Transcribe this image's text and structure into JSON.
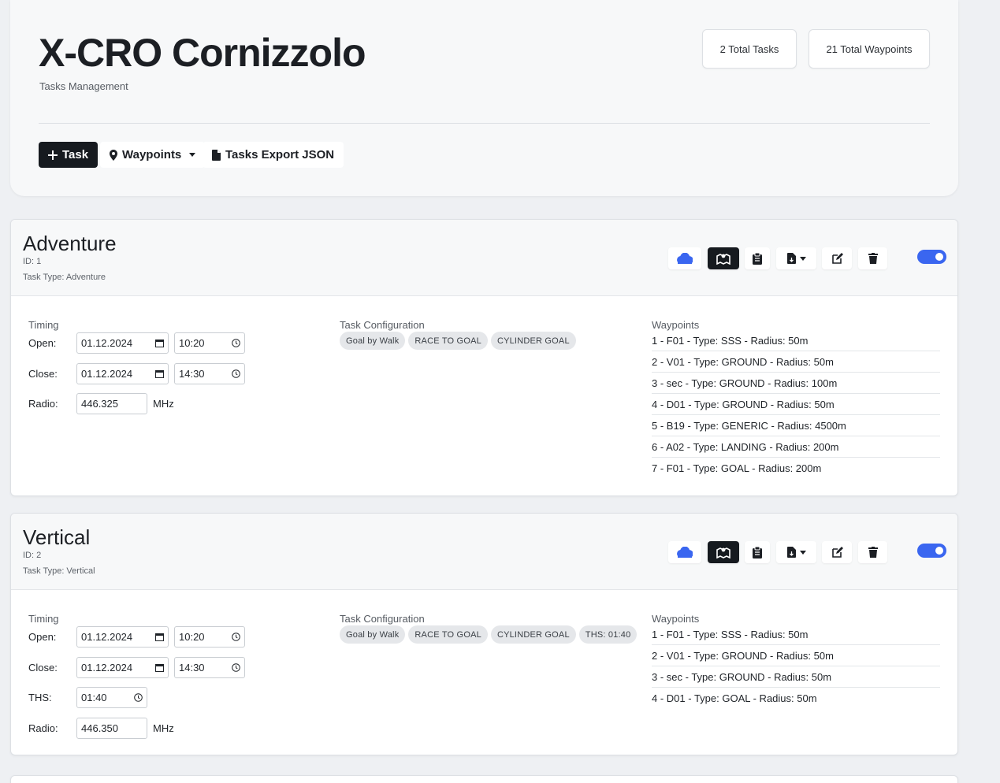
{
  "header": {
    "title": "X-CRO Cornizzolo",
    "subtitle": "Tasks Management",
    "stats": {
      "tasks": "2 Total Tasks",
      "waypoints": "21 Total Waypoints"
    },
    "buttons": {
      "add_task": "Task",
      "waypoints": "Waypoints",
      "export": "Tasks Export JSON"
    }
  },
  "labels": {
    "timing": "Timing",
    "config": "Task Configuration",
    "waypoints": "Waypoints",
    "open": "Open:",
    "close": "Close:",
    "ths": "THS:",
    "radio": "Radio:",
    "mhz": "MHz"
  },
  "colors": {
    "accent": "#3a66f0",
    "dark": "#161a1f",
    "cloud_icon": "#3a66f0"
  },
  "tasks": [
    {
      "name": "Adventure",
      "id": "ID: 1",
      "type": "Task Type: Adventure",
      "enabled": true,
      "open_date": "01.12.2024",
      "open_time": "10:20",
      "close_date": "01.12.2024",
      "close_time": "14:30",
      "radio": "446.325",
      "config": [
        "Goal by Walk",
        "RACE TO GOAL",
        "CYLINDER GOAL"
      ],
      "waypoints": [
        "1 - F01 - Type: SSS - Radius: 50m",
        "2 - V01 - Type: GROUND - Radius: 50m",
        "3 - sec - Type: GROUND - Radius: 100m",
        "4 - D01 - Type: GROUND - Radius: 50m",
        "5 - B19 - Type: GENERIC - Radius: 4500m",
        "6 - A02 - Type: LANDING - Radius: 200m",
        "7 - F01 - Type: GOAL - Radius: 200m"
      ]
    },
    {
      "name": "Vertical",
      "id": "ID: 2",
      "type": "Task Type: Vertical",
      "enabled": true,
      "open_date": "01.12.2024",
      "open_time": "10:20",
      "close_date": "01.12.2024",
      "close_time": "14:30",
      "ths": "01:40",
      "radio": "446.350",
      "config": [
        "Goal by Walk",
        "RACE TO GOAL",
        "CYLINDER GOAL",
        "THS: 01:40"
      ],
      "waypoints": [
        "1 - F01 - Type: SSS - Radius: 50m",
        "2 - V01 - Type: GROUND - Radius: 50m",
        "3 - sec - Type: GROUND - Radius: 50m",
        "4 - D01 - Type: GOAL - Radius: 50m"
      ]
    }
  ]
}
